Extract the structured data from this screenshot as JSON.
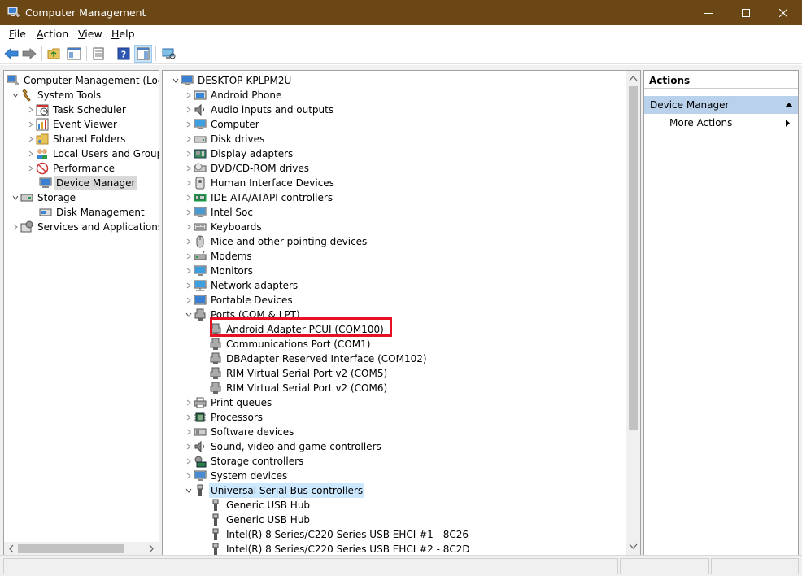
{
  "window": {
    "title": "Computer Management"
  },
  "menu": [
    {
      "label": "File",
      "accel": "F",
      "rest": "ile"
    },
    {
      "label": "Action",
      "accel": "A",
      "rest": "ction"
    },
    {
      "label": "View",
      "accel": "V",
      "rest": "iew"
    },
    {
      "label": "Help",
      "accel": "H",
      "rest": "elp"
    }
  ],
  "toolbar_icons": [
    "back-icon",
    "forward-icon",
    "up-folder-icon",
    "show-hide-tree-icon",
    "properties-icon",
    "help-icon",
    "show-action-pane-icon",
    "scan-hardware-icon"
  ],
  "left_tree": {
    "root": "Computer Management (Local",
    "system_tools": "System Tools",
    "task_scheduler": "Task Scheduler",
    "event_viewer": "Event Viewer",
    "shared_folders": "Shared Folders",
    "local_users": "Local Users and Groups",
    "performance": "Performance",
    "device_manager": "Device Manager",
    "storage": "Storage",
    "disk_management": "Disk Management",
    "services": "Services and Applications"
  },
  "device_tree": {
    "computer_name": "DESKTOP-KPLPM2U",
    "categories": [
      {
        "label": "Android Phone",
        "icon": "android-phone-icon"
      },
      {
        "label": "Audio inputs and outputs",
        "icon": "speaker-icon"
      },
      {
        "label": "Computer",
        "icon": "monitor-icon"
      },
      {
        "label": "Disk drives",
        "icon": "disk-drive-icon"
      },
      {
        "label": "Display adapters",
        "icon": "display-adapter-icon"
      },
      {
        "label": "DVD/CD-ROM drives",
        "icon": "dvd-icon"
      },
      {
        "label": "Human Interface Devices",
        "icon": "hid-icon"
      },
      {
        "label": "IDE ATA/ATAPI controllers",
        "icon": "ide-controller-icon"
      },
      {
        "label": "Intel Soc",
        "icon": "intel-soc-icon"
      },
      {
        "label": "Keyboards",
        "icon": "keyboard-icon"
      },
      {
        "label": "Mice and other pointing devices",
        "icon": "mouse-icon"
      },
      {
        "label": "Modems",
        "icon": "modem-icon"
      },
      {
        "label": "Monitors",
        "icon": "monitor-icon"
      },
      {
        "label": "Network adapters",
        "icon": "network-adapter-icon"
      },
      {
        "label": "Portable Devices",
        "icon": "portable-device-icon"
      }
    ],
    "ports_label": "Ports (COM & LPT)",
    "ports": [
      "Android Adapter PCUI (COM100)",
      "Communications Port (COM1)",
      "DBAdapter Reserved Interface (COM102)",
      "RIM Virtual Serial Port v2 (COM5)",
      "RIM Virtual Serial Port v2 (COM6)"
    ],
    "categories2": [
      {
        "label": "Print queues",
        "icon": "printer-icon"
      },
      {
        "label": "Processors",
        "icon": "processor-icon"
      },
      {
        "label": "Software devices",
        "icon": "software-device-icon"
      },
      {
        "label": "Sound, video and game controllers",
        "icon": "speaker-icon"
      },
      {
        "label": "Storage controllers",
        "icon": "storage-controller-icon"
      },
      {
        "label": "System devices",
        "icon": "system-device-icon"
      }
    ],
    "usb_label": "Universal Serial Bus controllers",
    "usb": [
      "Generic USB Hub",
      "Generic USB Hub",
      "Intel(R) 8 Series/C220 Series USB EHCI #1 - 8C26",
      "Intel(R) 8 Series/C220 Series USB EHCI #2 - 8C2D"
    ]
  },
  "actions": {
    "header": "Actions",
    "section": "Device Manager",
    "more": "More Actions"
  },
  "colors": {
    "titlebar": "#6b4716",
    "highlight_box": "#e81123",
    "actions_section": "#b9d1ea",
    "selection_blue": "#cce8ff"
  }
}
